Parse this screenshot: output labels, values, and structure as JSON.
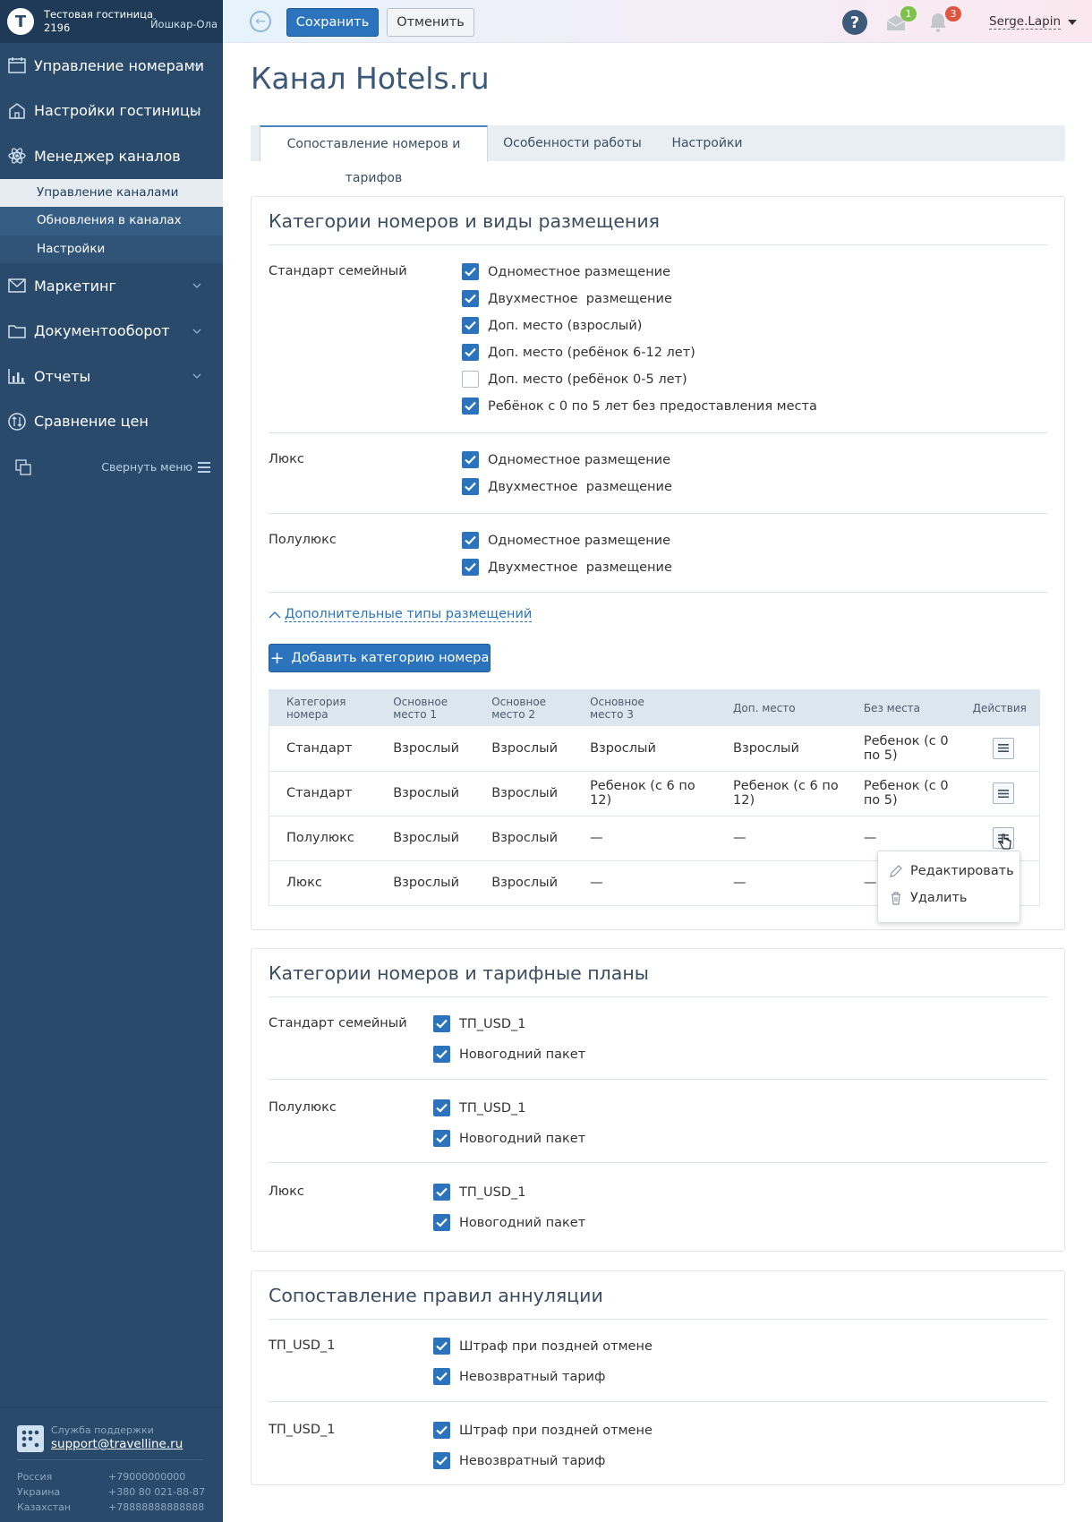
{
  "sidebar": {
    "hotel_name": "Тестовая гостиница",
    "hotel_id": "2196",
    "city": "Йошкар-Ола",
    "logo_letter": "T",
    "items": [
      {
        "label": "Управление номерами",
        "icon": "calendar-icon"
      },
      {
        "label": "Настройки гостиницы",
        "icon": "hotel-icon"
      },
      {
        "label": "Менеджер каналов",
        "icon": "atom-icon"
      },
      {
        "label": "Маркетинг",
        "icon": "envelope-icon"
      },
      {
        "label": "Документооборот",
        "icon": "folder-icon"
      },
      {
        "label": "Отчеты",
        "icon": "bar-chart-icon"
      },
      {
        "label": "Сравнение цен",
        "icon": "compare-icon"
      }
    ],
    "subitems": [
      "Управление каналами",
      "Обновления в каналах",
      "Настройки"
    ],
    "collapse_label": "Свернуть меню",
    "support": {
      "label": "Служба поддержки",
      "email": "support@travelline.ru",
      "phones": [
        {
          "country": "Россия",
          "number": "+79000000000"
        },
        {
          "country": "Украина",
          "number": "+380 80 021-88-87"
        },
        {
          "country": "Казахстан",
          "number": "+78888888888888"
        }
      ]
    }
  },
  "topbar": {
    "save_label": "Сохранить",
    "cancel_label": "Отменить",
    "help_glyph": "?",
    "messages_count": "1",
    "notifications_count": "3",
    "user_name": "Serge.Lapin"
  },
  "page": {
    "title": "Канал Hotels.ru",
    "tabs": [
      "Сопоставление номеров и тарифов",
      "Особенности работы",
      "Настройки"
    ],
    "active_tab": 0
  },
  "rooms_section": {
    "title": "Категории номеров и виды размещения",
    "groups": [
      {
        "name": "Стандарт семейный",
        "options": [
          {
            "label": "Одноместное размещение",
            "checked": true
          },
          {
            "label": "Двухместное  размещение",
            "checked": true
          },
          {
            "label": "Доп. место (взрослый)",
            "checked": true
          },
          {
            "label": "Доп. место (ребёнок 6-12 лет)",
            "checked": true
          },
          {
            "label": "Доп. место (ребёнок 0-5 лет)",
            "checked": false
          },
          {
            "label": "Ребёнок с 0 по 5 лет без предоставления места",
            "checked": true
          }
        ]
      },
      {
        "name": "Люкс",
        "options": [
          {
            "label": "Одноместное размещение",
            "checked": true
          },
          {
            "label": "Двухместное  размещение",
            "checked": true
          }
        ]
      },
      {
        "name": "Полулюкс",
        "options": [
          {
            "label": "Одноместное размещение",
            "checked": true
          },
          {
            "label": "Двухместное  размещение",
            "checked": true
          }
        ]
      }
    ],
    "more_link": "Дополнительные типы размещений",
    "add_button": "Добавить категорию номера",
    "table": {
      "headers": [
        "Категория номера",
        "Основное место 1",
        "Основное место 2",
        "Основное место 3",
        "Доп. место",
        "Без места",
        "Действия"
      ],
      "rows": [
        [
          "Стандарт",
          "Взрослый",
          "Взрослый",
          "Взрослый",
          "Взрослый",
          "Ребенок (с 0 по 5)"
        ],
        [
          "Стандарт",
          "Взрослый",
          "Взрослый",
          "Ребенок (с 6 по 12)",
          "Ребенок (с 6 по 12)",
          "Ребенок (с 0 по 5)"
        ],
        [
          "Полулюкс",
          "Взрослый",
          "Взрослый",
          "—",
          "—",
          "—"
        ],
        [
          "Люкс",
          "Взрослый",
          "Взрослый",
          "—",
          "—",
          "—"
        ]
      ]
    },
    "dropdown": {
      "edit": "Редактировать",
      "delete": "Удалить"
    }
  },
  "tariff_section": {
    "title": "Категории номеров и тарифные планы",
    "groups": [
      {
        "name": "Стандарт семейный",
        "options": [
          {
            "label": "ТП_USD_1",
            "checked": true
          },
          {
            "label": "Новогодний пакет",
            "checked": true
          }
        ]
      },
      {
        "name": "Полулюкс",
        "options": [
          {
            "label": "ТП_USD_1",
            "checked": true
          },
          {
            "label": "Новогодний пакет",
            "checked": true
          }
        ]
      },
      {
        "name": "Люкс",
        "options": [
          {
            "label": "ТП_USD_1",
            "checked": true
          },
          {
            "label": "Новогодний пакет",
            "checked": true
          }
        ]
      }
    ]
  },
  "cancel_section": {
    "title": "Сопоставление правил аннуляции",
    "groups": [
      {
        "name": "ТП_USD_1",
        "options": [
          {
            "label": "Штраф при поздней отмене",
            "checked": true
          },
          {
            "label": "Невозвратный тариф",
            "checked": true
          }
        ]
      },
      {
        "name": "ТП_USD_1",
        "options": [
          {
            "label": "Штраф при поздней отмене",
            "checked": true
          },
          {
            "label": "Невозвратный тариф",
            "checked": true
          }
        ]
      }
    ]
  },
  "colors": {
    "accent": "#2b74bd",
    "sidebar": "#2a4a6b",
    "title": "#3b5878"
  }
}
